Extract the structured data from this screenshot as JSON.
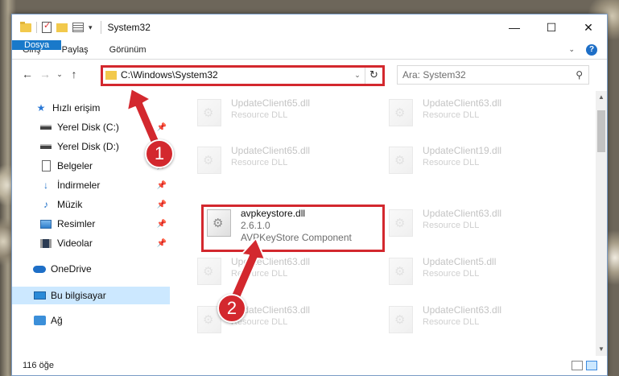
{
  "window": {
    "title": "System32",
    "controls": {
      "minimize": "—",
      "maximize": "☐",
      "close": "✕"
    }
  },
  "ribbon": {
    "tabs": [
      {
        "label": "Dosya",
        "active": true
      },
      {
        "label": "Giriş"
      },
      {
        "label": "Paylaş"
      },
      {
        "label": "Görünüm"
      }
    ]
  },
  "address": {
    "path": "C:\\Windows\\System32",
    "search_placeholder": "Ara: System32"
  },
  "sidebar": {
    "items": [
      {
        "label": "Hızlı erişim",
        "icon": "star-icon"
      },
      {
        "label": "Yerel Disk (C:)",
        "icon": "drive-icon",
        "pinned": true
      },
      {
        "label": "Yerel Disk (D:)",
        "icon": "drive-icon",
        "pinned": false
      },
      {
        "label": "Belgeler",
        "icon": "documents-icon",
        "pinned": true
      },
      {
        "label": "İndirmeler",
        "icon": "downloads-icon",
        "pinned": true
      },
      {
        "label": "Müzik",
        "icon": "music-icon",
        "pinned": true
      },
      {
        "label": "Resimler",
        "icon": "pictures-icon",
        "pinned": true
      },
      {
        "label": "Videolar",
        "icon": "videos-icon",
        "pinned": true
      },
      {
        "label": "OneDrive",
        "icon": "onedrive-icon"
      },
      {
        "label": "Bu bilgisayar",
        "icon": "computer-icon",
        "selected": true
      },
      {
        "label": "Ağ",
        "icon": "network-icon"
      }
    ]
  },
  "files": [
    {
      "name": "UpdateClient65.dll",
      "desc": "Resource DLL"
    },
    {
      "name": "UpdateClient63.dll",
      "desc": "Resource DLL"
    },
    {
      "name": "UpdateClient65.dll",
      "desc": "Resource DLL"
    },
    {
      "name": "UpdateClient19.dll",
      "desc": "Resource DLL"
    },
    {
      "name": "avpkeystore.dll",
      "version": "2.6.1.0",
      "desc": "AVPKeyStore Component",
      "highlighted": true
    },
    {
      "name": "UpdateClient63.dll",
      "desc": "Resource DLL"
    },
    {
      "name": "UpdateClient63.dll",
      "desc": "Resource DLL"
    },
    {
      "name": "UpdateClient5.dll",
      "desc": "Resource DLL"
    },
    {
      "name": "UpdateClient63.dll",
      "desc": "Resource DLL"
    },
    {
      "name": "UpdateClient63.dll",
      "desc": "Resource DLL"
    }
  ],
  "status": {
    "count": "116 öğe"
  },
  "annotations": {
    "step1": "1",
    "step2": "2"
  },
  "colors": {
    "accent": "#1979ca",
    "highlight": "#d3282e",
    "selected": "#cce8ff"
  }
}
